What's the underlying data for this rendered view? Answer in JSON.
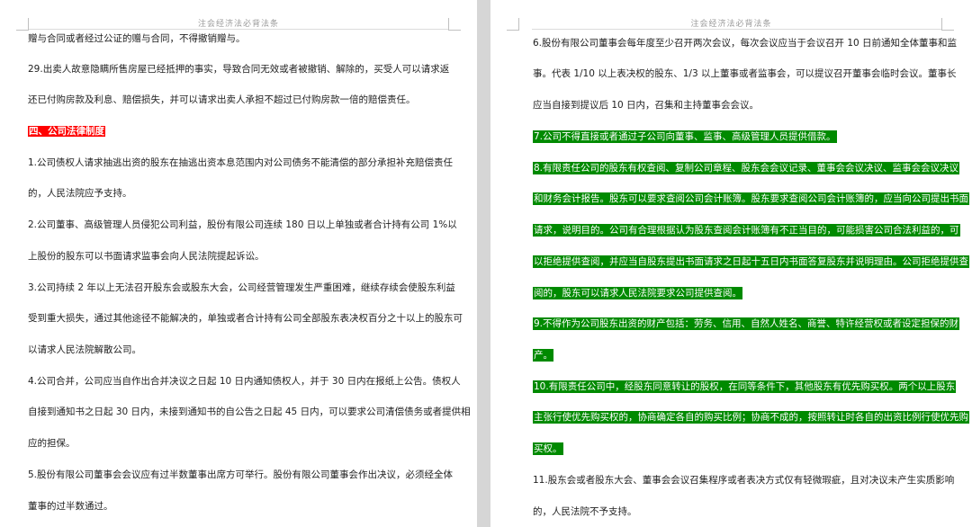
{
  "header_title": "注会经济法必背法条",
  "left_page": {
    "lines": [
      "赠与合同或者经过公证的赠与合同，不得撤销赠与。",
      "29.出卖人故意隐瞒所售房屋已经抵押的事实，导致合同无效或者被撤销、解除的，买受人可以请求返",
      "还已付购房款及利息、赔偿损失，并可以请求出卖人承担不超过已付购房款一倍的赔偿责任。",
      "四、公司法律制度",
      "1.公司债权人请求抽逃出资的股东在抽逃出资本息范围内对公司债务不能清偿的部分承担补充赔偿责任",
      "的，人民法院应予支持。",
      "2.公司董事、高级管理人员侵犯公司利益，股份有限公司连续 180 日以上单独或者合计持有公司 1%以",
      "上股份的股东可以书面请求监事会向人民法院提起诉讼。",
      "3.公司持续 2 年以上无法召开股东会或股东大会，公司经营管理发生严重困难，继续存续会使股东利益",
      "受到重大损失，通过其他途径不能解决的，单独或者合计持有公司全部股东表决权百分之十以上的股东可",
      "以请求人民法院解散公司。",
      "4.公司合并，公司应当自作出合并决议之日起 10 日内通知债权人，并于 30 日内在报纸上公告。债权人",
      "自接到通知书之日起 30 日内，未接到通知书的自公告之日起 45 日内，可以要求公司清偿债务或者提供相",
      "应的担保。",
      "5.股份有限公司董事会会议应有过半数董事出席方可举行。股份有限公司董事会作出决议，必须经全体",
      "董事的过半数通过。"
    ]
  },
  "right_page": {
    "lines": [
      "6.股份有限公司董事会每年度至少召开两次会议，每次会议应当于会议召开 10 日前通知全体董事和监",
      "事。代表 1/10 以上表决权的股东、1/3 以上董事或者监事会，可以提议召开董事会临时会议。董事长",
      "应当自接到提议后 10 日内，召集和主持董事会会议。",
      "7.公司不得直接或者通过子公司向董事、监事、高级管理人员提供借款。",
      "8.有限责任公司的股东有权查阅、复制公司章程、股东会会议记录、董事会会议决议、监事会会议决议",
      "和财务会计报告。股东可以要求查阅公司会计账簿。股东要求查阅公司会计账簿的，应当向公司提出书面",
      "请求，说明目的。公司有合理根据认为股东查阅会计账簿有不正当目的，可能损害公司合法利益的，可",
      "以拒绝提供查阅，并应当自股东提出书面请求之日起十五日内书面答复股东并说明理由。公司拒绝提供查",
      "阅的，股东可以请求人民法院要求公司提供查阅。",
      "9.不得作为公司股东出资的财产包括：劳务、信用、自然人姓名、商誉、特许经营权或者设定担保的财",
      "产。",
      "10.有限责任公司中，经股东同意转让的股权，在同等条件下，其他股东有优先购买权。两个以上股东",
      "主张行使优先购买权的，协商确定各自的购买比例；协商不成的，按照转让时各自的出资比例行使优先购",
      "买权。",
      "11.股东会或者股东大会、董事会会议召集程序或者表决方式仅有轻微瑕疵，且对决议未产生实质影响",
      "的，人民法院不予支持。"
    ]
  },
  "colors": {
    "red_highlight": "#ff0000",
    "green_highlight": "#008a00",
    "gutter": "#d6d6d6"
  }
}
